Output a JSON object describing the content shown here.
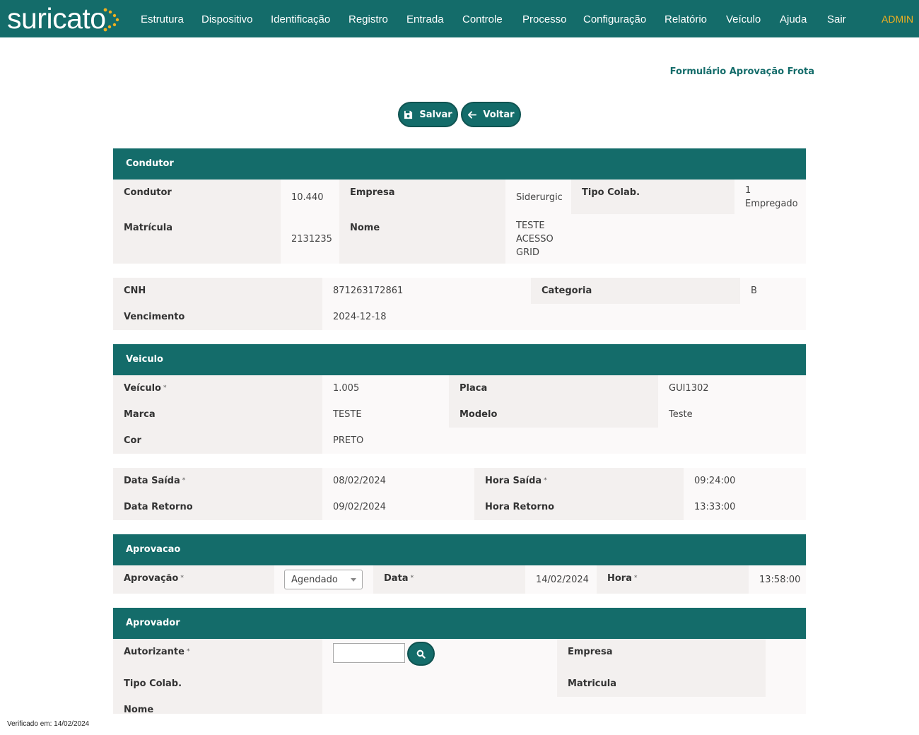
{
  "app": {
    "logo_text": "suricato",
    "user": "ADMIN"
  },
  "nav": [
    "Estrutura",
    "Dispositivo",
    "Identificação",
    "Registro",
    "Entrada",
    "Controle",
    "Processo",
    "Configuração",
    "Relatório",
    "Veículo",
    "Ajuda",
    "Sair"
  ],
  "form_title": "Formulário Aprovação Frota",
  "buttons": {
    "save": "Salvar",
    "back": "Voltar"
  },
  "condutor": {
    "header": "Condutor",
    "condutor_label": "Condutor",
    "condutor_value": "10.440",
    "empresa_label": "Empresa",
    "empresa_value": "Siderurgic",
    "tipo_label": "Tipo Colab.",
    "tipo_value_1": "1",
    "tipo_value_2": "Empregado",
    "matricula_label": "Matrícula",
    "matricula_value": "2131235",
    "nome_label": "Nome",
    "nome_value_1": "TESTE",
    "nome_value_2": "ACESSO",
    "nome_value_3": "GRID"
  },
  "cnh": {
    "cnh_label": "CNH",
    "cnh_value": "871263172861",
    "categoria_label": "Categoria",
    "categoria_value": "B",
    "vencimento_label": "Vencimento",
    "vencimento_value": "2024-12-18"
  },
  "veiculo": {
    "header": "Veiculo",
    "veiculo_label": "Veículo",
    "veiculo_value": "1.005",
    "placa_label": "Placa",
    "placa_value": "GUI1302",
    "marca_label": "Marca",
    "marca_value": "TESTE",
    "modelo_label": "Modelo",
    "modelo_value": "Teste",
    "cor_label": "Cor",
    "cor_value": "PRETO"
  },
  "datas": {
    "saida_label": "Data Saída",
    "saida_value": "08/02/2024",
    "hora_saida_label": "Hora Saída",
    "hora_saida_value": "09:24:00",
    "retorno_label": "Data Retorno",
    "retorno_value": "09/02/2024",
    "hora_retorno_label": "Hora Retorno",
    "hora_retorno_value": "13:33:00"
  },
  "aprovacao": {
    "header": "Aprovacao",
    "aprovacao_label": "Aprovação",
    "aprovacao_value": "Agendado",
    "data_label": "Data",
    "data_value": "14/02/2024",
    "hora_label": "Hora",
    "hora_value": "13:58:00"
  },
  "aprovador": {
    "header": "Aprovador",
    "autorizante_label": "Autorizante",
    "autorizante_value": "",
    "empresa_label": "Empresa",
    "tipo_label": "Tipo Colab.",
    "matricula_label": "Matricula",
    "nome_label": "Nome"
  },
  "footer": "Verificado em: 14/02/2024",
  "colors": {
    "primary": "#146c6a",
    "accent": "#f2b01e",
    "label_bg": "#f3f0ef",
    "panel_bg": "#fbf9f9"
  }
}
